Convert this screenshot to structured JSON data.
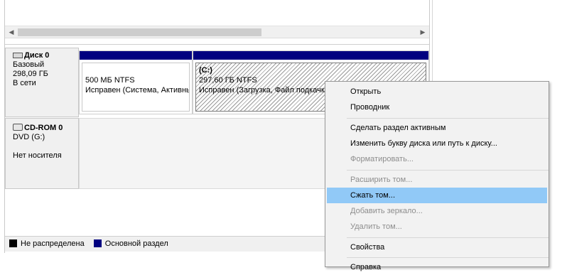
{
  "disks": [
    {
      "name": "Диск 0",
      "type": "Базовый",
      "size": "298,09 ГБ",
      "status": "В сети"
    },
    {
      "name": "CD-ROM 0",
      "type": "DVD (G:)",
      "size": "",
      "status": "Нет носителя"
    }
  ],
  "partitions": [
    {
      "label": "",
      "size": "500 МБ NTFS",
      "status": "Исправен (Система, Активный, Основной раздел)"
    },
    {
      "label": "(C:)",
      "size": "297,60 ГБ NTFS",
      "status": "Исправен (Загрузка, Файл подкачки, Аварийный дамп, Основной раздел)"
    }
  ],
  "legend": [
    {
      "label": "Не распределена",
      "color": "#000000"
    },
    {
      "label": "Основной раздел",
      "color": "#000080"
    }
  ],
  "context_menu": [
    {
      "label": "Открыть",
      "disabled": false
    },
    {
      "label": "Проводник",
      "disabled": false
    },
    {
      "label": "Сделать раздел активным",
      "disabled": false
    },
    {
      "label": "Изменить букву диска или путь к диску...",
      "disabled": false
    },
    {
      "label": "Форматировать...",
      "disabled": true
    },
    {
      "label": "Расширить том...",
      "disabled": true
    },
    {
      "label": "Сжать том...",
      "disabled": false,
      "highlighted": true
    },
    {
      "label": "Добавить зеркало...",
      "disabled": true
    },
    {
      "label": "Удалить том...",
      "disabled": true
    },
    {
      "label": "Свойства",
      "disabled": false
    },
    {
      "label": "Справка",
      "disabled": false
    }
  ]
}
